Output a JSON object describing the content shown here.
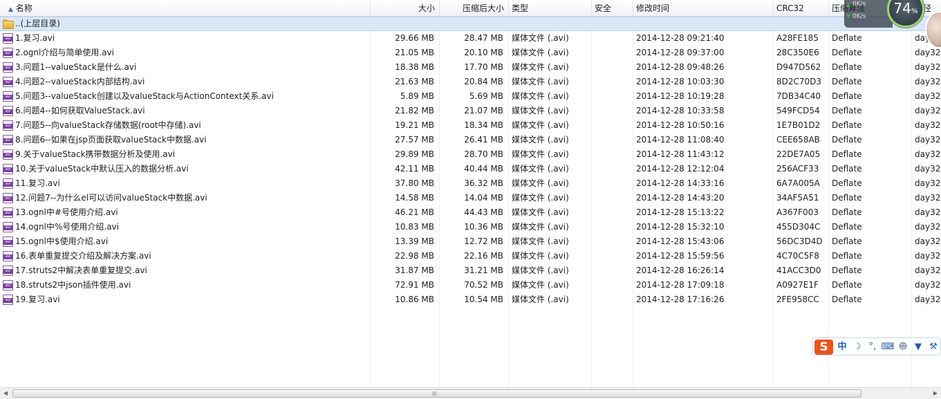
{
  "columns": [
    {
      "key": "name",
      "label": "名称"
    },
    {
      "key": "size",
      "label": "大小"
    },
    {
      "key": "packed",
      "label": "压缩后大小"
    },
    {
      "key": "type",
      "label": "类型"
    },
    {
      "key": "secure",
      "label": "安全"
    },
    {
      "key": "modified",
      "label": "修改时间"
    },
    {
      "key": "crc",
      "label": "CRC32"
    },
    {
      "key": "method",
      "label": "压缩算法"
    },
    {
      "key": "path",
      "label": "路径"
    }
  ],
  "parent_label": "..(上层目录)",
  "files": [
    {
      "name": "1.复习.avi",
      "size": "29.66 MB",
      "packed": "28.47 MB",
      "type": "媒体文件 (.avi)",
      "modified": "2014-12-28 09:21:40",
      "crc": "A28FE185",
      "method": "Deflate",
      "path": "day32"
    },
    {
      "name": "2.ognl介绍与简单使用.avi",
      "size": "21.05 MB",
      "packed": "20.10 MB",
      "type": "媒体文件 (.avi)",
      "modified": "2014-12-28 09:37:00",
      "crc": "28C350E6",
      "method": "Deflate",
      "path": "day32"
    },
    {
      "name": "3.问题1--valueStack是什么.avi",
      "size": "18.38 MB",
      "packed": "17.70 MB",
      "type": "媒体文件 (.avi)",
      "modified": "2014-12-28 09:48:26",
      "crc": "D947D562",
      "method": "Deflate",
      "path": "day32"
    },
    {
      "name": "4.问题2--valueStack内部结构.avi",
      "size": "21.63 MB",
      "packed": "20.84 MB",
      "type": "媒体文件 (.avi)",
      "modified": "2014-12-28 10:03:30",
      "crc": "8D2C70D3",
      "method": "Deflate",
      "path": "day32"
    },
    {
      "name": "5.问题3--valueStack创建以及valueStack与ActionContext关系.avi",
      "size": "5.89 MB",
      "packed": "5.69 MB",
      "type": "媒体文件 (.avi)",
      "modified": "2014-12-28 10:19:28",
      "crc": "7DB34C40",
      "method": "Deflate",
      "path": "day32"
    },
    {
      "name": "6.问题4--如何获取ValueStack.avi",
      "size": "21.82 MB",
      "packed": "21.07 MB",
      "type": "媒体文件 (.avi)",
      "modified": "2014-12-28 10:33:58",
      "crc": "549FCD54",
      "method": "Deflate",
      "path": "day32"
    },
    {
      "name": "7.问题5--向valueStack存储数据(root中存储).avi",
      "size": "19.21 MB",
      "packed": "18.34 MB",
      "type": "媒体文件 (.avi)",
      "modified": "2014-12-28 10:50:16",
      "crc": "1E7B01D2",
      "method": "Deflate",
      "path": "day32"
    },
    {
      "name": "8.问题6--如果在jsp页面获取valueStack中数据.avi",
      "size": "27.57 MB",
      "packed": "26.41 MB",
      "type": "媒体文件 (.avi)",
      "modified": "2014-12-28 11:08:40",
      "crc": "CEE658AB",
      "method": "Deflate",
      "path": "day32"
    },
    {
      "name": "9.关于valueStack携带数据分析及使用.avi",
      "size": "29.89 MB",
      "packed": "28.70 MB",
      "type": "媒体文件 (.avi)",
      "modified": "2014-12-28 11:43:12",
      "crc": "22DE7A05",
      "method": "Deflate",
      "path": "day32"
    },
    {
      "name": "10.关于valueStack中默认压入的数据分析.avi",
      "size": "42.11 MB",
      "packed": "40.44 MB",
      "type": "媒体文件 (.avi)",
      "modified": "2014-12-28 12:12:04",
      "crc": "256ACF33",
      "method": "Deflate",
      "path": "day32"
    },
    {
      "name": "11.复习.avi",
      "size": "37.80 MB",
      "packed": "36.32 MB",
      "type": "媒体文件 (.avi)",
      "modified": "2014-12-28 14:33:16",
      "crc": "6A7A005A",
      "method": "Deflate",
      "path": "day32"
    },
    {
      "name": "12.问题7--为什么el可以访问valueStack中数据.avi",
      "size": "14.58 MB",
      "packed": "14.04 MB",
      "type": "媒体文件 (.avi)",
      "modified": "2014-12-28 14:43:20",
      "crc": "34AF5A51",
      "method": "Deflate",
      "path": "day32"
    },
    {
      "name": "13.ognl中#号使用介绍.avi",
      "size": "46.21 MB",
      "packed": "44.43 MB",
      "type": "媒体文件 (.avi)",
      "modified": "2014-12-28 15:13:22",
      "crc": "A367F003",
      "method": "Deflate",
      "path": "day32"
    },
    {
      "name": "14.ognl中%号使用介绍.avi",
      "size": "10.83 MB",
      "packed": "10.36 MB",
      "type": "媒体文件 (.avi)",
      "modified": "2014-12-28 15:32:10",
      "crc": "455D304C",
      "method": "Deflate",
      "path": "day32"
    },
    {
      "name": "15.ognl中$使用介绍.avi",
      "size": "13.39 MB",
      "packed": "12.72 MB",
      "type": "媒体文件 (.avi)",
      "modified": "2014-12-28 15:43:06",
      "crc": "56DC3D4D",
      "method": "Deflate",
      "path": "day32"
    },
    {
      "name": "16.表单重复提交介绍及解决方案.avi",
      "size": "22.98 MB",
      "packed": "22.16 MB",
      "type": "媒体文件 (.avi)",
      "modified": "2014-12-28 15:59:56",
      "crc": "4C70C5F8",
      "method": "Deflate",
      "path": "day32"
    },
    {
      "name": "17.struts2中解决表单重复提交.avi",
      "size": "31.87 MB",
      "packed": "31.21 MB",
      "type": "媒体文件 (.avi)",
      "modified": "2014-12-28 16:26:14",
      "crc": "41ACC3D0",
      "method": "Deflate",
      "path": "day32"
    },
    {
      "name": "18.struts2中json插件使用.avi",
      "size": "72.91 MB",
      "packed": "70.52 MB",
      "type": "媒体文件 (.avi)",
      "modified": "2014-12-28 17:09:18",
      "crc": "A0927E1F",
      "method": "Deflate",
      "path": "day32"
    },
    {
      "name": "19.复习.avi",
      "size": "10.86 MB",
      "packed": "10.54 MB",
      "type": "媒体文件 (.avi)",
      "modified": "2014-12-28 17:16:26",
      "crc": "2FE958CC",
      "method": "Deflate",
      "path": "day32"
    }
  ],
  "net_widget": {
    "upload": "0K/s",
    "download": "0K/s",
    "percent": "74",
    "percent_sign": "%",
    "ring_color": "#9fd36a"
  },
  "ime_toolbar": {
    "logo": "S",
    "mode": "中",
    "icons": [
      "moon-icon",
      "punctuation-icon",
      "keyboard-icon",
      "user-icon",
      "skin-shirt-icon",
      "wrench-icon"
    ]
  },
  "scrollbar": {
    "grip": "III"
  },
  "colors": {
    "selection_row": "#d9e7f8",
    "avi_icon": "#7b3fa0",
    "ime_logo": "#e8541e",
    "ime_icons": "#1f5fb0"
  }
}
